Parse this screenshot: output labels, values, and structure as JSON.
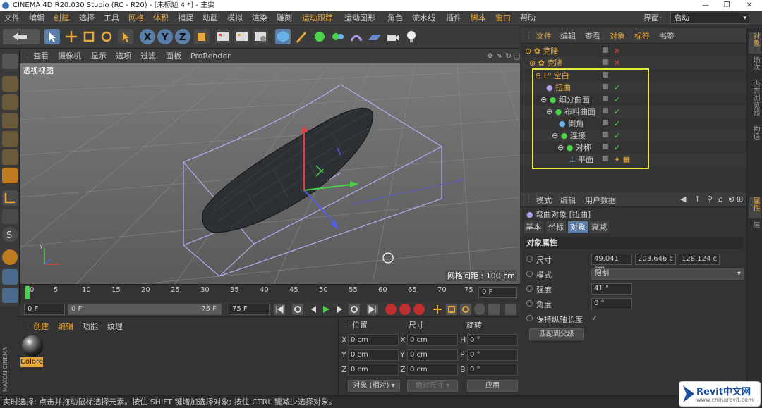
{
  "window": {
    "title": "CINEMA 4D R20.030 Studio (RC - R20) - [未标题 4 *] - 主要",
    "minimize": "—",
    "maximize": "❐",
    "close": "✕"
  },
  "menubar": {
    "items": [
      "文件",
      "编辑",
      "创建",
      "选择",
      "工具",
      "网格",
      "体积",
      "捕捉",
      "动画",
      "模拟",
      "渲染",
      "雕刻",
      "运动跟踪",
      "运动图形",
      "角色",
      "流水线",
      "插件",
      "脚本",
      "窗口",
      "帮助"
    ],
    "layout_label": "界面:",
    "layout_value": "启动"
  },
  "viewport": {
    "menu": [
      "查看",
      "摄像机",
      "显示",
      "选项",
      "过滤",
      "面板",
      "ProRender"
    ],
    "label": "透视视图",
    "grid_label": "网格间距 : 100 cm"
  },
  "timeline": {
    "ticks": [
      "0",
      "5",
      "10",
      "15",
      "20",
      "25",
      "30",
      "35",
      "40",
      "45",
      "50",
      "55",
      "60",
      "65",
      "70",
      "75"
    ],
    "current": "0 F"
  },
  "playback": {
    "start": "0 F",
    "range_start": "0 F",
    "range_end": "75 F",
    "end": "75 F"
  },
  "material_manager": {
    "menu": [
      "创建",
      "编辑",
      "功能",
      "纹理"
    ],
    "material_name": "Colore"
  },
  "coordinates": {
    "headers": [
      "位置",
      "尺寸",
      "旋转"
    ],
    "rows": [
      {
        "a": "X",
        "pos": "0 cm",
        "b": "X",
        "size": "0 cm",
        "c": "H",
        "rot": "0 °"
      },
      {
        "a": "Y",
        "pos": "0 cm",
        "b": "Y",
        "size": "0 cm",
        "c": "P",
        "rot": "0 °"
      },
      {
        "a": "Z",
        "pos": "0 cm",
        "b": "Z",
        "size": "0 cm",
        "c": "B",
        "rot": "0 °"
      }
    ],
    "mode": "对象 (相对)",
    "size_mode": "绝对尺寸",
    "apply": "应用"
  },
  "object_manager": {
    "menu": [
      "文件",
      "编辑",
      "查看",
      "对象",
      "标签",
      "书签"
    ],
    "objects": [
      {
        "name": "克隆",
        "color": "#e8a83a",
        "indent": 0
      },
      {
        "name": "克隆",
        "color": "#e8a83a",
        "indent": 1
      },
      {
        "name": "空白",
        "color": "#e8a83a",
        "indent": 1
      },
      {
        "name": "扭曲",
        "color": "#e8a83a",
        "indent": 2
      },
      {
        "name": "细分曲面",
        "color": "#ccc",
        "indent": 2
      },
      {
        "name": "布料曲面",
        "color": "#ccc",
        "indent": 3
      },
      {
        "name": "倒角",
        "color": "#ccc",
        "indent": 4
      },
      {
        "name": "连接",
        "color": "#ccc",
        "indent": 4
      },
      {
        "name": "对称",
        "color": "#ccc",
        "indent": 5
      },
      {
        "name": "平面",
        "color": "#ccc",
        "indent": 6
      }
    ]
  },
  "attribute_manager": {
    "menu": [
      "模式",
      "编辑",
      "用户数据"
    ],
    "object_title": "弯曲对象 [扭曲]",
    "tabs": [
      "基本",
      "坐标",
      "对象",
      "衰减"
    ],
    "active_tab": "对象",
    "section": "对象属性",
    "size_label": "尺寸",
    "size_values": [
      "49.041 cm",
      "203.646 c",
      "128.124 c"
    ],
    "mode_label": "模式",
    "mode_value": "限制",
    "strength_label": "强度",
    "strength_value": "41 °",
    "angle_label": "角度",
    "angle_value": "0 °",
    "keep_length_label": "保持纵轴长度",
    "keep_length_check": "✓",
    "fit_button": "匹配到父级"
  },
  "right_tabs": [
    "对象",
    "场次",
    "内容浏览器",
    "构造",
    "属性",
    "层"
  ],
  "status": "实时选择: 点击并拖动鼠标选择元素。按住 SHIFT 键增加选择对象; 按住 CTRL 键减少选择对象。",
  "brand": "MAXON CINEMA 4D",
  "watermark": {
    "main": "Revit中文网",
    "sub": "www.chinarevit.com"
  }
}
